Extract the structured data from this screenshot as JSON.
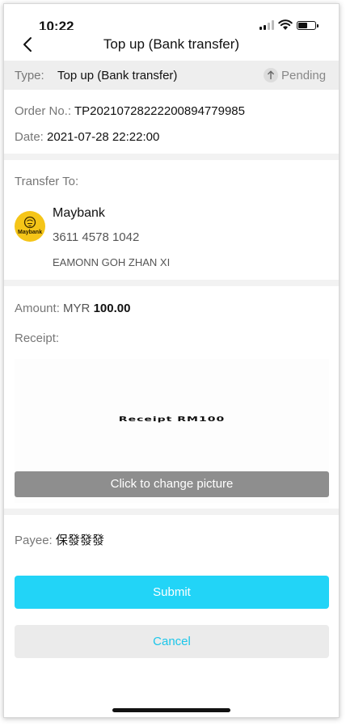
{
  "status_bar": {
    "time": "10:22"
  },
  "header": {
    "title": "Top up (Bank transfer)"
  },
  "type_row": {
    "label": "Type:",
    "value": "Top up (Bank transfer)",
    "status": "Pending"
  },
  "order": {
    "order_no_label": "Order No.:",
    "order_no": "TP20210728222200894779985",
    "date_label": "Date:",
    "date": "2021-07-28 22:22:00"
  },
  "transfer": {
    "label": "Transfer To:",
    "bank_logo_text": "Maybank",
    "bank_name": "Maybank",
    "account_number": "3611 4578 1042",
    "account_name": "EAMONN GOH ZHAN XI"
  },
  "payment": {
    "amount_label": "Amount:",
    "currency": "MYR",
    "amount": "100.00",
    "receipt_label": "Receipt:",
    "receipt_image_text": "Receipt RM100",
    "change_picture_label": "Click to change picture"
  },
  "payee": {
    "label": "Payee:",
    "value": "保發發發"
  },
  "actions": {
    "submit_label": "Submit",
    "cancel_label": "Cancel"
  },
  "colors": {
    "accent": "#22d4f7",
    "cancel_text": "#1cc6ea",
    "maybank_yellow": "#f5c518",
    "change_picture_bg": "#8e8e8e"
  }
}
